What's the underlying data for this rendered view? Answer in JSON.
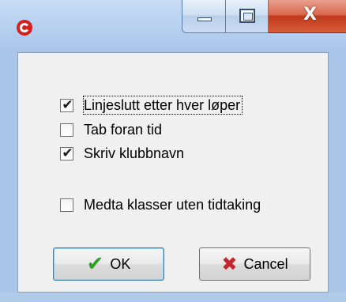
{
  "window": {
    "minimize_label": "",
    "maximize_label": "",
    "close_glyph": "X",
    "app_icon": "app-logo-icon"
  },
  "options": [
    {
      "label": "Linjeslutt etter hver løper",
      "checked": true
    },
    {
      "label": "Tab foran tid",
      "checked": false
    },
    {
      "label": "Skriv klubbnavn",
      "checked": true
    },
    {
      "label": "Medta klasser uten tidtaking",
      "checked": false
    }
  ],
  "tick_glyph": "✔",
  "buttons": {
    "ok_label": "OK",
    "ok_icon": "checkmark-icon",
    "cancel_label": "Cancel",
    "cancel_icon": "cross-icon"
  },
  "colors": {
    "accent_check": "#2f9e2a",
    "accent_cross": "#c1272d",
    "close_button": "#c1391c"
  }
}
